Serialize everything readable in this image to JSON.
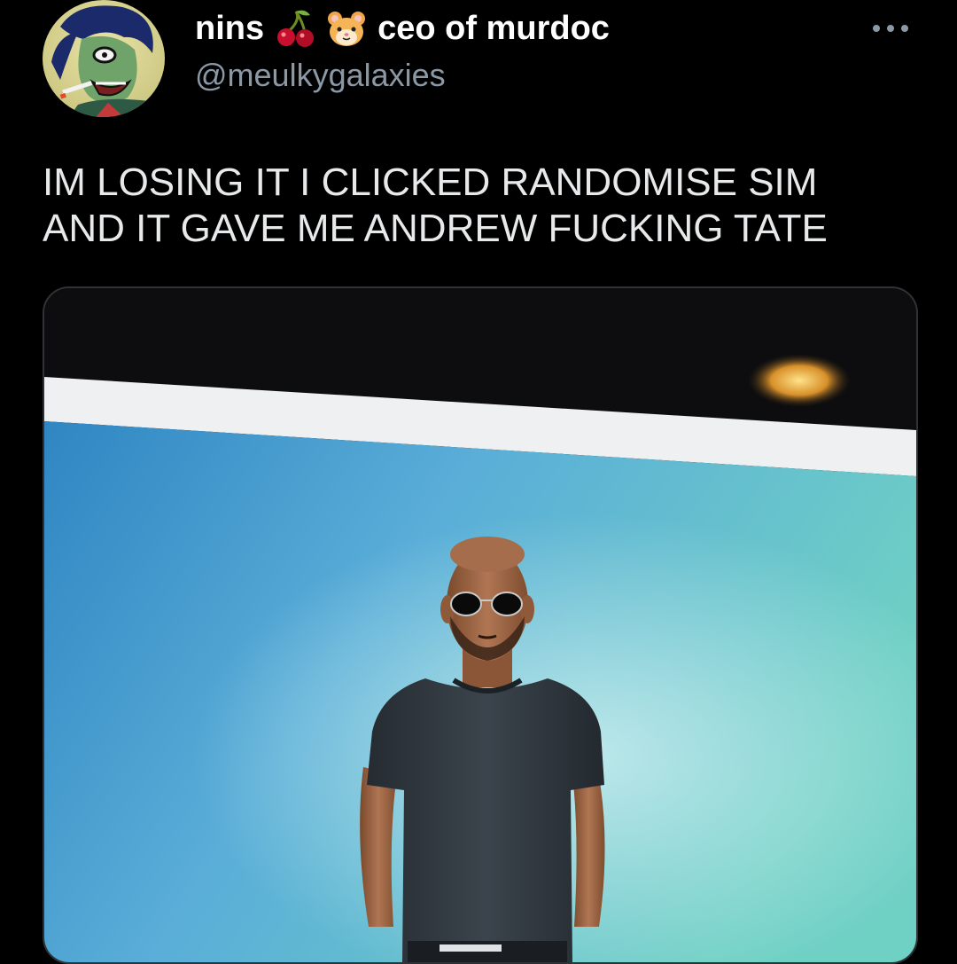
{
  "tweet": {
    "author": {
      "display_name_first": "nins",
      "display_name_second": "ceo of murdoc",
      "handle": "@meulkygalaxies",
      "name_emojis": [
        "cherry-icon",
        "hamster-face-icon"
      ],
      "avatar_icon": "cartoon-character-avatar"
    },
    "more_icon": "more-horizontal-icon",
    "text_line_1": "IM LOSING IT I CLICKED RANDOMISE SIM",
    "text_line_2": "AND IT GAVE ME ANDREW FUCKING TATE",
    "media": {
      "kind": "photo-of-screen",
      "subject": "sim-character-photo"
    }
  },
  "colors": {
    "background": "#000000",
    "text": "#e7e9ea",
    "secondary_text": "#8b98a5",
    "media_border": "#2f3336"
  }
}
